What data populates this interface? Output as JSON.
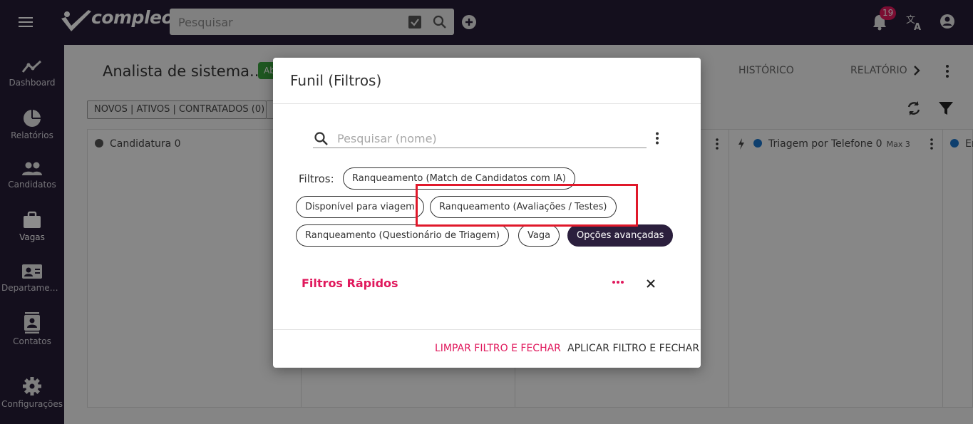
{
  "app": {
    "logo_text": "compleo",
    "search_placeholder": "Pesquisar",
    "notification_count": "19",
    "accent_color": "#e0185c",
    "nav_bg": "#261c35"
  },
  "sidebar": {
    "items": [
      {
        "label": "Dashboard",
        "icon": "chart-line-icon"
      },
      {
        "label": "Relatórios",
        "icon": "pie-chart-icon"
      },
      {
        "label": "Candidatos",
        "icon": "people-icon"
      },
      {
        "label": "Vagas",
        "icon": "briefcase-icon"
      },
      {
        "label": "Departamento",
        "icon": "contact-card-icon"
      },
      {
        "label": "Contatos",
        "icon": "contacts-book-icon"
      },
      {
        "label": "Configurações",
        "icon": "gear-icon"
      }
    ]
  },
  "page": {
    "title": "Analista de sistema...",
    "status_label": "Ab",
    "tabs": [
      "HISTÓRICO",
      "RELATÓRIO"
    ],
    "filter_chip": "NOVOS | ATIVOS | CONTRATADOS (0)",
    "columns": [
      {
        "title": "Candidatura 0",
        "dot_color": "#555555"
      },
      {
        "title": "Triagem por Telefone 0",
        "max": "Max 3",
        "dot_color": "#1a73c9"
      },
      {
        "title": "En",
        "dot_color": "#1a73c9"
      }
    ]
  },
  "modal": {
    "title": "Funil (Filtros)",
    "search_placeholder": "Pesquisar (nome)",
    "filters_label": "Filtros:",
    "chips": [
      "Ranqueamento (Match de Candidatos com IA)",
      "Disponível para viagem",
      "Ranqueamento (Avaliações / Testes)",
      "Ranqueamento (Questionário de Triagem)",
      "Vaga",
      "Opções avançadas"
    ],
    "quick_filters_label": "Filtros Rápidos",
    "clear_button": "LIMPAR FILTRO E FECHAR",
    "apply_button": "APLICAR FILTRO E FECHAR"
  }
}
